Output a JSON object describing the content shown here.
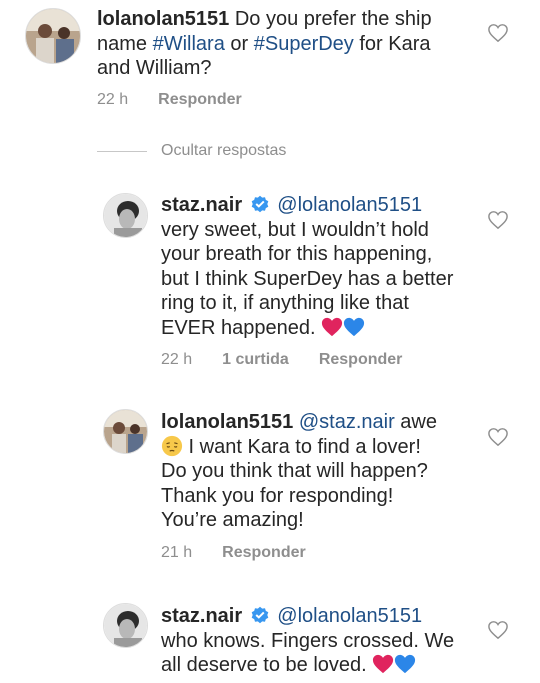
{
  "comments": [
    {
      "username": "lolanolan5151",
      "body_prefix": "Do you prefer the ship",
      "line2_text_a": "name ",
      "hashtag1": "#Willara",
      "line2_text_b": " or ",
      "hashtag2": "#SuperDey",
      "line2_text_c": " for Kara",
      "line3": "and William?",
      "time": "22 h",
      "reply": "Responder"
    },
    {
      "username": "staz.nair",
      "mention": "@lolanolan5151",
      "lines": [
        "very sweet, but I wouldn’t hold",
        "your breath for this happening,",
        "but I think SuperDey has a better",
        "ring to it, if anything like that",
        "EVER happened."
      ],
      "time": "22 h",
      "likes": "1 curtida",
      "reply": "Responder"
    },
    {
      "username": "lolanolan5151",
      "mention": "@staz.nair",
      "mention_suffix": " awe",
      "lines": [
        " I want Kara to find a lover!",
        "Do you think that will happen?",
        "Thank you for responding!",
        "You’re amazing!"
      ],
      "time": "21 h",
      "reply": "Responder"
    },
    {
      "username": "staz.nair",
      "mention": "@lolanolan5151",
      "lines": [
        "who knows. Fingers crossed. We",
        "all deserve to be loved."
      ]
    }
  ],
  "hide_replies": "Ocultar respostas",
  "colors": {
    "text": "#262626",
    "muted": "#8e8e8e",
    "link": "#1f4f86",
    "verified": "#3897f0",
    "red_heart": "#e0245e",
    "blue_heart": "#2b86e8"
  },
  "icons": [
    "heart-outline-icon",
    "verified-badge-icon",
    "red-heart-emoji",
    "blue-heart-emoji",
    "pensive-face-emoji"
  ]
}
